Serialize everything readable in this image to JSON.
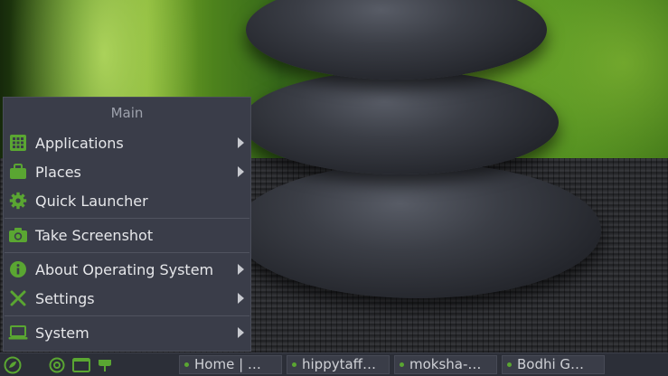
{
  "menu": {
    "title": "Main",
    "items": [
      {
        "label": "Applications",
        "icon": "applications-grid-icon",
        "submenu": true
      },
      {
        "label": "Places",
        "icon": "folder-bag-icon",
        "submenu": true
      },
      {
        "label": "Quick Launcher",
        "icon": "gear-icon",
        "submenu": false
      },
      {
        "label": "Take Screenshot",
        "icon": "camera-icon",
        "submenu": false
      },
      {
        "label": "About Operating System",
        "icon": "info-icon",
        "submenu": true
      },
      {
        "label": "Settings",
        "icon": "tools-icon",
        "submenu": true
      },
      {
        "label": "System",
        "icon": "laptop-icon",
        "submenu": true
      }
    ]
  },
  "taskbar": {
    "launchers": [
      "bodhi-menu-icon",
      "browser-icon",
      "terminal-icon",
      "plant-icon"
    ],
    "tasks": [
      {
        "label": "Home | …"
      },
      {
        "label": "hippytaff…"
      },
      {
        "label": "moksha-…"
      },
      {
        "label": "Bodhi G…"
      }
    ]
  },
  "colors": {
    "accent": "#5aa632",
    "menu_bg": "#3a3d49",
    "menu_text": "#e6e7ea",
    "menu_title": "#9ea2ad",
    "taskbar_bg": "#2c2f38"
  }
}
